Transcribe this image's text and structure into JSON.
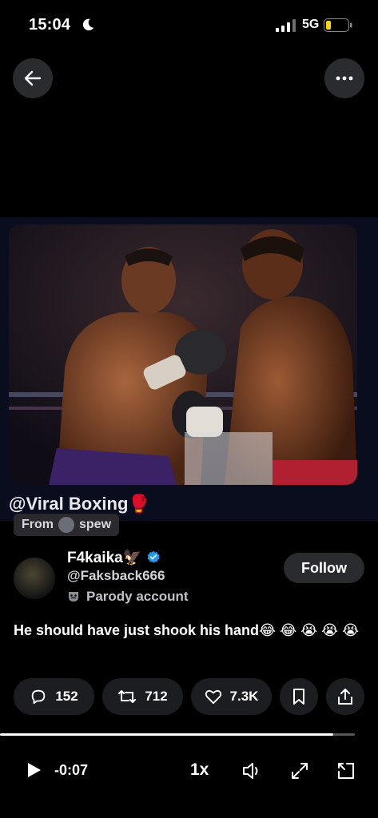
{
  "status_bar": {
    "time": "15:04",
    "network": "5G"
  },
  "media": {
    "caption": "@Viral Boxing🥊",
    "from_label": "From",
    "from_user": "spew"
  },
  "author": {
    "display_name": "F4kaika🦅",
    "handle": "@Faksback666",
    "parody_label": "Parody account",
    "follow_label": "Follow"
  },
  "tweet": {
    "text": "He should have just shook his hand😂 😂 😭 😭 😭"
  },
  "actions": {
    "replies": "152",
    "reposts": "712",
    "likes": "7.3K"
  },
  "player": {
    "time_remaining": "-0:07",
    "speed": "1x",
    "progress": 0.94
  },
  "colors": {
    "verified": "#1d9bf0",
    "background": "#000000",
    "pill": "#1c1d20"
  },
  "icons": [
    "moon-icon",
    "signal-icon",
    "battery-icon",
    "back-arrow-icon",
    "more-icon",
    "verified-badge-icon",
    "parody-mask-icon",
    "reply-icon",
    "repost-icon",
    "like-icon",
    "bookmark-icon",
    "share-icon",
    "play-icon",
    "volume-icon",
    "expand-icon",
    "exit-icon"
  ]
}
